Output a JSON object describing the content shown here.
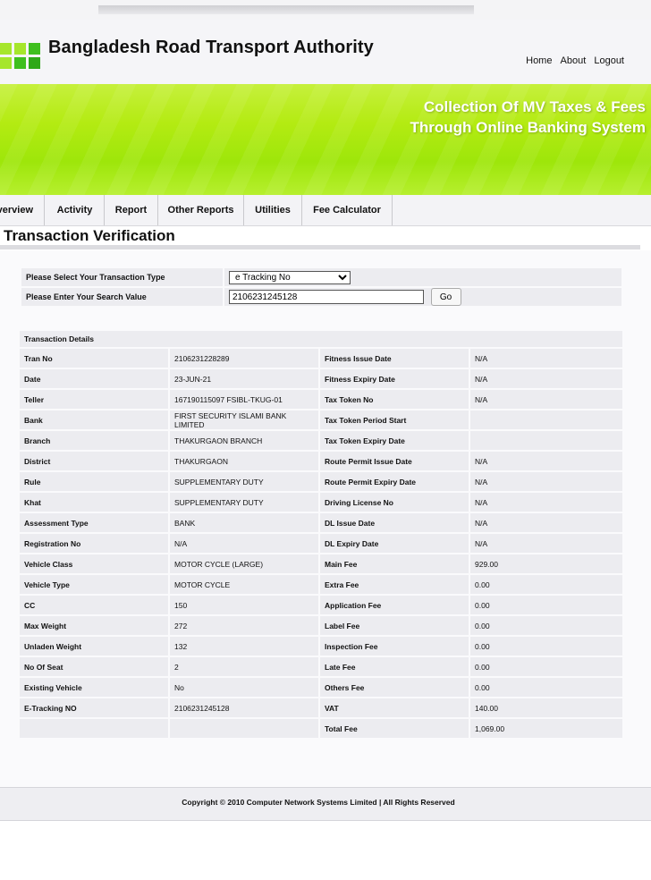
{
  "header": {
    "site_title": "Bangladesh Road Transport Authority",
    "links": [
      "Home",
      "About",
      "Logout"
    ]
  },
  "banner": {
    "line1": "Collection Of MV Taxes & Fees",
    "line2": "Through Online Banking System"
  },
  "nav": {
    "tabs": [
      "Overview",
      "Activity",
      "Report",
      "Other Reports",
      "Utilities",
      "Fee Calculator"
    ]
  },
  "page": {
    "title": "Transaction Verification"
  },
  "search": {
    "type_label": "Please Select Your Transaction Type",
    "type_value": "e Tracking No",
    "value_label": "Please Enter Your Search Value",
    "value": "2106231245128",
    "go_label": "Go"
  },
  "details": {
    "heading": "Transaction Details",
    "rows": [
      {
        "l1": "Tran No",
        "v1": "2106231228289",
        "l2": "Fitness Issue Date",
        "v2": "N/A"
      },
      {
        "l1": "Date",
        "v1": "23-JUN-21",
        "l2": "Fitness Expiry Date",
        "v2": "N/A"
      },
      {
        "l1": "Teller",
        "v1": "167190115097 FSIBL-TKUG-01",
        "l2": "Tax Token No",
        "v2": "N/A"
      },
      {
        "l1": "Bank",
        "v1": "FIRST SECURITY ISLAMI BANK LIMITED",
        "l2": "Tax Token Period Start",
        "v2": ""
      },
      {
        "l1": "Branch",
        "v1": "THAKURGAON BRANCH",
        "l2": "Tax Token Expiry Date",
        "v2": ""
      },
      {
        "l1": "District",
        "v1": "THAKURGAON",
        "l2": "Route Permit Issue Date",
        "v2": "N/A"
      },
      {
        "l1": "Rule",
        "v1": "SUPPLEMENTARY DUTY",
        "l2": "Route Permit Expiry Date",
        "v2": "N/A"
      },
      {
        "l1": "Khat",
        "v1": "SUPPLEMENTARY DUTY",
        "l2": "Driving License No",
        "v2": "N/A"
      },
      {
        "l1": "Assessment Type",
        "v1": "BANK",
        "l2": "DL Issue Date",
        "v2": "N/A"
      },
      {
        "l1": "Registration No",
        "v1": "N/A",
        "l2": "DL Expiry Date",
        "v2": "N/A"
      },
      {
        "l1": "Vehicle Class",
        "v1": "MOTOR CYCLE (LARGE)",
        "l2": "Main Fee",
        "v2": "929.00"
      },
      {
        "l1": "Vehicle Type",
        "v1": "MOTOR CYCLE",
        "l2": "Extra Fee",
        "v2": "0.00"
      },
      {
        "l1": "CC",
        "v1": "150",
        "l2": "Application Fee",
        "v2": "0.00"
      },
      {
        "l1": "Max Weight",
        "v1": "272",
        "l2": "Label Fee",
        "v2": "0.00"
      },
      {
        "l1": "Unladen Weight",
        "v1": "132",
        "l2": "Inspection Fee",
        "v2": "0.00"
      },
      {
        "l1": "No Of Seat",
        "v1": "2",
        "l2": "Late Fee",
        "v2": "0.00"
      },
      {
        "l1": "Existing Vehicle",
        "v1": "No",
        "l2": "Others Fee",
        "v2": "0.00"
      },
      {
        "l1": "E-Tracking NO",
        "v1": "2106231245128",
        "l2": "VAT",
        "v2": "140.00"
      },
      {
        "l1": "",
        "v1": "",
        "l2": "Total Fee",
        "v2": "1,069.00"
      }
    ]
  },
  "footer": {
    "text": "Copyright © 2010 Computer Network Systems Limited | All Rights Reserved"
  },
  "colors": {
    "banner_green": "#b4eb12",
    "logo_green": "#3fbf1f",
    "logo_light": "#a6e62c"
  }
}
